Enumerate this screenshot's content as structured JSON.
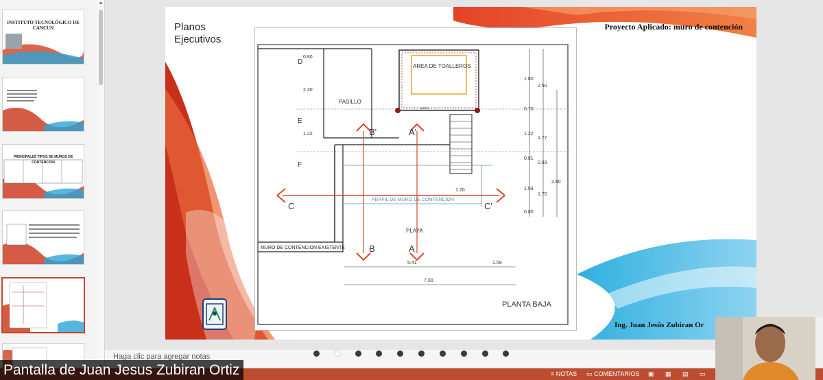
{
  "thumbnails": [
    {
      "title": "INSTITUTO TECNOLÓGICO DE CANCUN"
    },
    {
      "title": ""
    },
    {
      "title": "PRINCIPALES TIPOS DE MUROS DE CONTENCION"
    },
    {
      "title": ""
    },
    {
      "title": ""
    },
    {
      "title": ""
    }
  ],
  "slide": {
    "label_line1": "Planos",
    "label_line2": "Ejecutivos",
    "project_title": "Proyecto Aplicado: muro de contención",
    "author": "Ing. Juan Jesús Zubiran Or",
    "plan": {
      "rooms": {
        "toallero": "AREA DE TOALLEROS",
        "pasillo": "PASILLO",
        "playa": "PLAYA"
      },
      "axes": {
        "d": "D",
        "e": "E",
        "f": "F"
      },
      "cuts": {
        "a": "A",
        "a_prime": "A'",
        "b": "B",
        "b_prime": "B'",
        "c": "C",
        "c_prime": "C'"
      },
      "notes": {
        "muro_existente": "MURO DE CONTENCION EXISTENTE",
        "planta_baja": "PLANTA BAJA",
        "cut_line_label": "PERFIL DE MURO DE CONTENCION",
        "barra": "BARRA"
      },
      "dims_left": [
        "0.80",
        "2.30",
        "1.22"
      ],
      "dims_right": [
        "1.80",
        "2.50",
        "0.70",
        "1.22",
        "1.77",
        "0.91",
        "0.93",
        "1.59",
        "1.70",
        "2.80",
        "0.80"
      ],
      "dims_misc": {
        "d_120": "1.20",
        "d_541": "5.41",
        "d_159": "1.59",
        "d_700": "7.00"
      }
    }
  },
  "notes_placeholder": "Haga clic para agregar notas",
  "page_dots_count": 10,
  "page_dots_active": 1,
  "screen_share_label": "Pantalla de Juan Jesus Zubiran Ortiz",
  "status": {
    "notes": "NOTAS",
    "comments": "COMENTARIOS"
  },
  "colors": {
    "accent": "#bd4d31",
    "cut_arrow": "#d9472b",
    "selected_thumb_border": "#c9442c"
  }
}
